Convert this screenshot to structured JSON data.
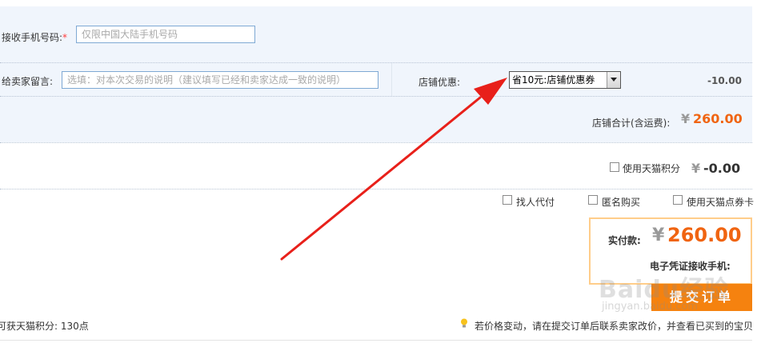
{
  "receiver": {
    "phone_label": "接收手机号码:",
    "required_mark": "*",
    "phone_placeholder": "仅限中国大陆手机号码"
  },
  "message": {
    "label": "给卖家留言:",
    "placeholder": "选填：对本次交易的说明（建议填写已经和卖家达成一致的说明）"
  },
  "store_discount": {
    "label": "店铺优惠:",
    "selected_option": "省10元:店铺优惠券",
    "amount": "-10.00"
  },
  "store_total": {
    "label": "店铺合计(含运费):",
    "currency": "¥",
    "amount": "260.00"
  },
  "points": {
    "label": "使用天猫积分",
    "currency": "¥",
    "amount": "-0.00"
  },
  "options": [
    {
      "label": "找人代付"
    },
    {
      "label": "匿名购买"
    },
    {
      "label": "使用天猫点券卡"
    }
  ],
  "payment": {
    "label": "实付款:",
    "currency": "¥",
    "amount": "260.00",
    "phone_label": "电子凭证接收手机:"
  },
  "submit_label": "提交订单",
  "footer": {
    "points_text": "可获天猫积分: 130点",
    "notice": "若价格变动，请在提交订单后联系卖家改价，并查看已买到的宝贝"
  },
  "watermark": {
    "brand": "Baidu经验",
    "url": "jingyan.baidu.com"
  },
  "colors": {
    "accent_orange": "#f06411",
    "panel_bg": "#f0f5fc",
    "annotation_arrow": "#e8201a",
    "submit_bg": "#f5820f"
  }
}
